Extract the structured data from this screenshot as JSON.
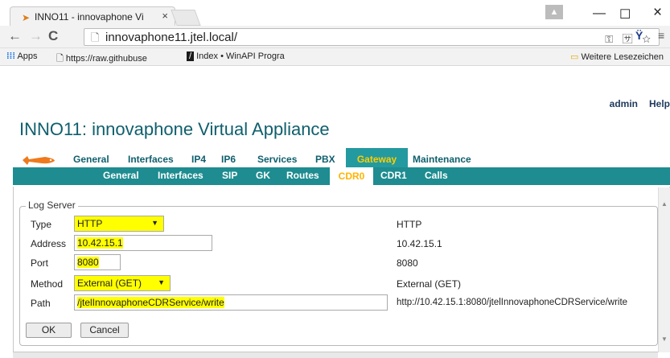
{
  "browser": {
    "tab_title": "INNO11 - innovaphone Vi",
    "tab_close": "×",
    "url": "innovaphone11.jtel.local/",
    "window_controls": {
      "minimize": "—",
      "maximize": "☐",
      "close": "×"
    },
    "bookmarks": {
      "apps": "Apps",
      "item1": "https://raw.githubuse",
      "item2": "Index • WinAPI Progra",
      "other": "Weitere Lesezeichen"
    },
    "icons": [
      "back-arrow-icon",
      "forward-arrow-icon",
      "reload-icon",
      "page-icon",
      "key-icon",
      "translate-icon",
      "star-icon",
      "extension-icon",
      "menu-icon"
    ]
  },
  "header": {
    "user_links": [
      "admin",
      "Help"
    ],
    "title": "INNO11: innovaphone Virtual Appliance"
  },
  "nav_main": {
    "items": [
      "General",
      "Interfaces",
      "IP4",
      "IP6",
      "Services",
      "PBX",
      "Gateway",
      "Maintenance"
    ],
    "active": "Gateway"
  },
  "nav_sub": {
    "items": [
      "General",
      "Interfaces",
      "SIP",
      "GK",
      "Routes",
      "CDR0",
      "CDR1",
      "Calls"
    ],
    "active": "CDR0"
  },
  "log_server": {
    "legend": "Log Server",
    "type": {
      "label": "Type",
      "value": "HTTP",
      "display": "HTTP"
    },
    "address": {
      "label": "Address",
      "value": "10.42.15.1",
      "display": "10.42.15.1"
    },
    "port": {
      "label": "Port",
      "value": "8080",
      "display": "8080"
    },
    "method": {
      "label": "Method",
      "value": "External (GET)",
      "display": "External (GET)"
    },
    "path": {
      "label": "Path",
      "value": "/jtelInnovaphoneCDRService/write",
      "display": "http://10.42.15.1:8080/jtelInnovaphoneCDRService/write"
    }
  },
  "buttons": {
    "ok": "OK",
    "cancel": "Cancel"
  },
  "colors": {
    "teal": "#1e8c90",
    "title_teal": "#0f5f6d",
    "active_tab": "#ffcd00",
    "highlight": "#ffff00"
  }
}
